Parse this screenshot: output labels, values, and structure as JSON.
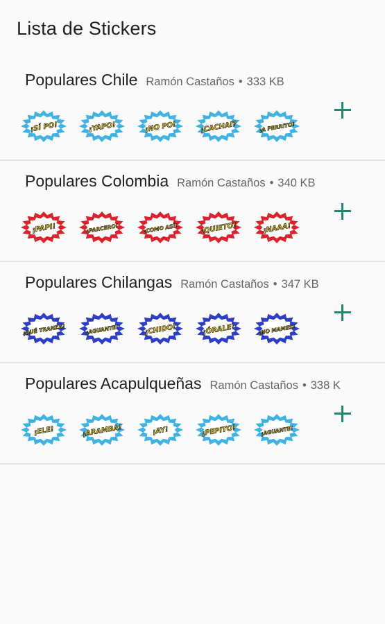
{
  "app": {
    "title": "Lista de Stickers"
  },
  "packs": [
    {
      "name": "Populares Chile",
      "publisher": "Ramón Castaños",
      "size": "333 KB",
      "burst_color": "#3fb3e6",
      "stickers": [
        "¡SÍ PO!",
        "¡YAPO!",
        "¡NO PO!",
        "¡CACHAI?",
        "¡A PERRITO!"
      ]
    },
    {
      "name": "Populares Colombia",
      "publisher": "Ramón Castaños",
      "size": "340 KB",
      "burst_color": "#e0202a",
      "stickers": [
        "¡PAPI!",
        "¡PARCERO!",
        "¡COMO ASÍ!",
        "¡QUIETO!",
        "¡NAAA!"
      ]
    },
    {
      "name": "Populares Chilangas",
      "publisher": "Ramón Castaños",
      "size": "347 KB",
      "burst_color": "#2d3fc9",
      "stickers": [
        "¡QUÉ TRANZA!",
        "¡AGUANTE!",
        "¡CHIDO!",
        "¡ÓRALE!",
        "¡NO MAMES!"
      ]
    },
    {
      "name": "Populares Acapulqueñas",
      "publisher": "Ramón Castaños",
      "size": "338 K",
      "burst_color": "#3fb3e6",
      "stickers": [
        "¡ELE!",
        "¡ARAMBA!",
        "¡AY!",
        "¡PEPITO!",
        "¡AGUANTE!"
      ]
    }
  ]
}
